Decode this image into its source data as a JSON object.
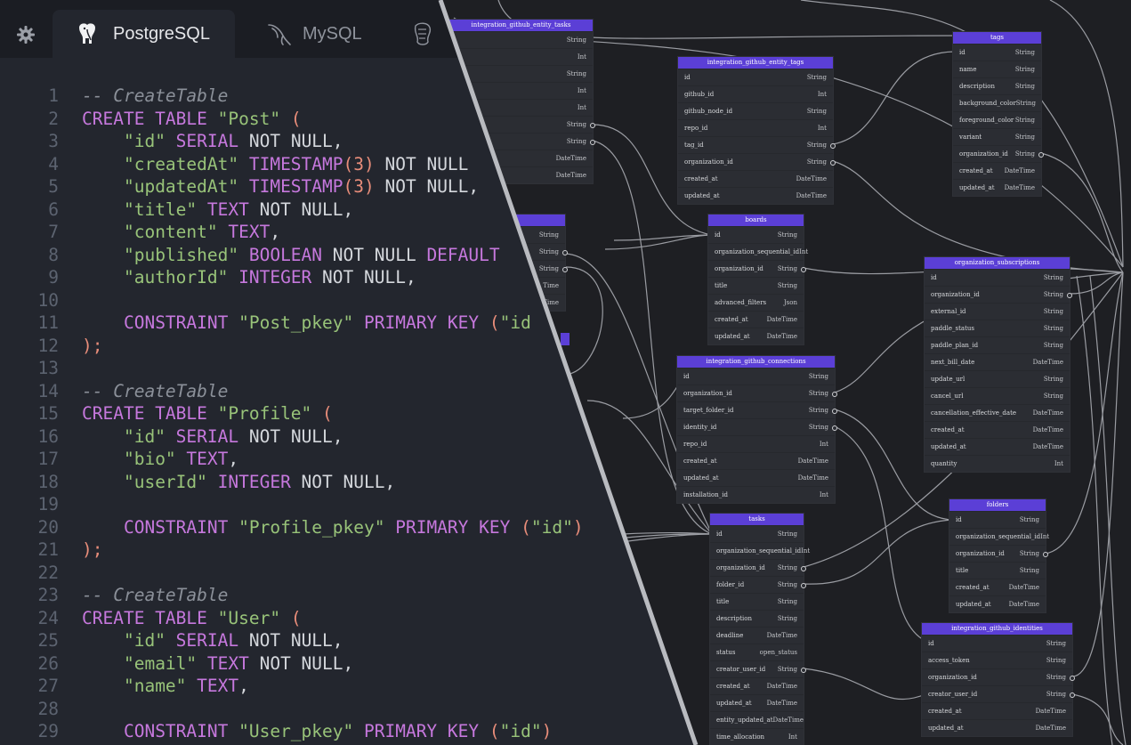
{
  "tabs": [
    {
      "label": "PostgreSQL",
      "icon": "elephant-icon",
      "active": true
    },
    {
      "label": "MySQL",
      "icon": "dolphin-icon",
      "active": false
    },
    {
      "label": "",
      "icon": "database-icon",
      "active": false
    }
  ],
  "code": [
    {
      "n": "1",
      "t": [
        [
          "c",
          "-- CreateTable"
        ]
      ]
    },
    {
      "n": "2",
      "t": [
        [
          "k",
          "CREATE TABLE "
        ],
        [
          "s",
          "\"Post\""
        ],
        [
          "p",
          " ("
        ]
      ]
    },
    {
      "n": "3",
      "t": [
        [
          "d",
          "    "
        ],
        [
          "s",
          "\"id\""
        ],
        [
          "k",
          " SERIAL"
        ],
        [
          "d",
          " NOT NULL,"
        ]
      ]
    },
    {
      "n": "4",
      "t": [
        [
          "d",
          "    "
        ],
        [
          "s",
          "\"createdAt\""
        ],
        [
          "k",
          " TIMESTAMP"
        ],
        [
          "p",
          "(3)"
        ],
        [
          "d",
          " NOT NULL"
        ]
      ]
    },
    {
      "n": "5",
      "t": [
        [
          "d",
          "    "
        ],
        [
          "s",
          "\"updatedAt\""
        ],
        [
          "k",
          " TIMESTAMP"
        ],
        [
          "p",
          "(3)"
        ],
        [
          "d",
          " NOT NULL,"
        ]
      ]
    },
    {
      "n": "6",
      "t": [
        [
          "d",
          "    "
        ],
        [
          "s",
          "\"title\""
        ],
        [
          "k",
          " TEXT"
        ],
        [
          "d",
          " NOT NULL,"
        ]
      ]
    },
    {
      "n": "7",
      "t": [
        [
          "d",
          "    "
        ],
        [
          "s",
          "\"content\""
        ],
        [
          "k",
          " TEXT"
        ],
        [
          "d",
          ","
        ]
      ]
    },
    {
      "n": "8",
      "t": [
        [
          "d",
          "    "
        ],
        [
          "s",
          "\"published\""
        ],
        [
          "k",
          " BOOLEAN"
        ],
        [
          "d",
          " NOT NULL "
        ],
        [
          "k",
          "DEFAULT"
        ]
      ]
    },
    {
      "n": "9",
      "t": [
        [
          "d",
          "    "
        ],
        [
          "s",
          "\"authorId\""
        ],
        [
          "k",
          " INTEGER"
        ],
        [
          "d",
          " NOT NULL,"
        ]
      ]
    },
    {
      "n": "10",
      "t": []
    },
    {
      "n": "11",
      "t": [
        [
          "d",
          "    "
        ],
        [
          "k",
          "CONSTRAINT "
        ],
        [
          "s",
          "\"Post_pkey\""
        ],
        [
          "k",
          " PRIMARY KEY "
        ],
        [
          "p",
          "("
        ],
        [
          "s",
          "\"id"
        ]
      ]
    },
    {
      "n": "12",
      "t": [
        [
          "p",
          ");"
        ]
      ]
    },
    {
      "n": "13",
      "t": []
    },
    {
      "n": "14",
      "t": [
        [
          "c",
          "-- CreateTable"
        ]
      ]
    },
    {
      "n": "15",
      "t": [
        [
          "k",
          "CREATE TABLE "
        ],
        [
          "s",
          "\"Profile\""
        ],
        [
          "p",
          " ("
        ]
      ]
    },
    {
      "n": "16",
      "t": [
        [
          "d",
          "    "
        ],
        [
          "s",
          "\"id\""
        ],
        [
          "k",
          " SERIAL"
        ],
        [
          "d",
          " NOT NULL,"
        ]
      ]
    },
    {
      "n": "17",
      "t": [
        [
          "d",
          "    "
        ],
        [
          "s",
          "\"bio\""
        ],
        [
          "k",
          " TEXT"
        ],
        [
          "d",
          ","
        ]
      ]
    },
    {
      "n": "18",
      "t": [
        [
          "d",
          "    "
        ],
        [
          "s",
          "\"userId\""
        ],
        [
          "k",
          " INTEGER"
        ],
        [
          "d",
          " NOT NULL,"
        ]
      ]
    },
    {
      "n": "19",
      "t": []
    },
    {
      "n": "20",
      "t": [
        [
          "d",
          "    "
        ],
        [
          "k",
          "CONSTRAINT "
        ],
        [
          "s",
          "\"Profile_pkey\""
        ],
        [
          "k",
          " PRIMARY KEY "
        ],
        [
          "p",
          "("
        ],
        [
          "s",
          "\"id\""
        ],
        [
          "p",
          ")"
        ]
      ]
    },
    {
      "n": "21",
      "t": [
        [
          "p",
          ");"
        ]
      ]
    },
    {
      "n": "22",
      "t": []
    },
    {
      "n": "23",
      "t": [
        [
          "c",
          "-- CreateTable"
        ]
      ]
    },
    {
      "n": "24",
      "t": [
        [
          "k",
          "CREATE TABLE "
        ],
        [
          "s",
          "\"User\""
        ],
        [
          "p",
          " ("
        ]
      ]
    },
    {
      "n": "25",
      "t": [
        [
          "d",
          "    "
        ],
        [
          "s",
          "\"id\""
        ],
        [
          "k",
          " SERIAL"
        ],
        [
          "d",
          " NOT NULL,"
        ]
      ]
    },
    {
      "n": "26",
      "t": [
        [
          "d",
          "    "
        ],
        [
          "s",
          "\"email\""
        ],
        [
          "k",
          " TEXT"
        ],
        [
          "d",
          " NOT NULL,"
        ]
      ]
    },
    {
      "n": "27",
      "t": [
        [
          "d",
          "    "
        ],
        [
          "s",
          "\"name\""
        ],
        [
          "k",
          " TEXT"
        ],
        [
          "d",
          ","
        ]
      ]
    },
    {
      "n": "28",
      "t": []
    },
    {
      "n": "29",
      "t": [
        [
          "d",
          "    "
        ],
        [
          "k",
          "CONSTRAINT "
        ],
        [
          "s",
          "\"User_pkey\""
        ],
        [
          "k",
          " PRIMARY KEY "
        ],
        [
          "p",
          "("
        ],
        [
          "s",
          "\"id\""
        ],
        [
          "p",
          ")"
        ]
      ]
    }
  ],
  "tables": [
    {
      "id": "t-egt",
      "name": "integration_github_entity_tasks",
      "rows": [
        [
          "",
          "String"
        ],
        [
          "",
          "Int"
        ],
        [
          "",
          "String"
        ],
        [
          "",
          "Int"
        ],
        [
          "",
          "Int"
        ],
        [
          "",
          "String"
        ],
        [
          "",
          "String"
        ],
        [
          "",
          "DateTime"
        ],
        [
          "",
          "DateTime"
        ]
      ]
    },
    {
      "id": "t-small",
      "name": "",
      "rows": [
        [
          "",
          "String"
        ],
        [
          "",
          "String"
        ],
        [
          "",
          "String"
        ],
        [
          "",
          "Time"
        ],
        [
          "",
          "Time"
        ]
      ]
    },
    {
      "id": "t-egtags",
      "name": "integration_github_entity_tags",
      "rows": [
        [
          "id",
          "String"
        ],
        [
          "github_id",
          "Int"
        ],
        [
          "github_node_id",
          "String"
        ],
        [
          "repo_id",
          "Int"
        ],
        [
          "tag_id",
          "String"
        ],
        [
          "organization_id",
          "String"
        ],
        [
          "created_at",
          "DateTime"
        ],
        [
          "updated_at",
          "DateTime"
        ]
      ]
    },
    {
      "id": "t-tags",
      "name": "tags",
      "rows": [
        [
          "id",
          "String"
        ],
        [
          "name",
          "String"
        ],
        [
          "description",
          "String"
        ],
        [
          "background_color",
          "String"
        ],
        [
          "foreground_color",
          "String"
        ],
        [
          "variant",
          "String"
        ],
        [
          "organization_id",
          "String"
        ],
        [
          "created_at",
          "DateTime"
        ],
        [
          "updated_at",
          "DateTime"
        ]
      ]
    },
    {
      "id": "t-boards",
      "name": "boards",
      "rows": [
        [
          "id",
          "String"
        ],
        [
          "organization_sequential_id",
          "Int"
        ],
        [
          "organization_id",
          "String"
        ],
        [
          "title",
          "String"
        ],
        [
          "advanced_filters",
          "Json"
        ],
        [
          "created_at",
          "DateTime"
        ],
        [
          "updated_at",
          "DateTime"
        ]
      ]
    },
    {
      "id": "t-subs",
      "name": "organization_subscriptions",
      "rows": [
        [
          "id",
          "String"
        ],
        [
          "organization_id",
          "String"
        ],
        [
          "external_id",
          "String"
        ],
        [
          "paddle_status",
          "String"
        ],
        [
          "paddle_plan_id",
          "String"
        ],
        [
          "next_bill_date",
          "DateTime"
        ],
        [
          "update_url",
          "String"
        ],
        [
          "cancel_url",
          "String"
        ],
        [
          "cancellation_effective_date",
          "DateTime"
        ],
        [
          "created_at",
          "DateTime"
        ],
        [
          "updated_at",
          "DateTime"
        ],
        [
          "quantity",
          "Int"
        ]
      ]
    },
    {
      "id": "t-conn",
      "name": "integration_github_connections",
      "rows": [
        [
          "id",
          "String"
        ],
        [
          "organization_id",
          "String"
        ],
        [
          "target_folder_id",
          "String"
        ],
        [
          "identity_id",
          "String"
        ],
        [
          "repo_id",
          "Int"
        ],
        [
          "created_at",
          "DateTime"
        ],
        [
          "updated_at",
          "DateTime"
        ],
        [
          "installation_id",
          "Int"
        ]
      ]
    },
    {
      "id": "t-folders",
      "name": "folders",
      "rows": [
        [
          "id",
          "String"
        ],
        [
          "organization_sequential_id",
          "Int"
        ],
        [
          "organization_id",
          "String"
        ],
        [
          "title",
          "String"
        ],
        [
          "created_at",
          "DateTime"
        ],
        [
          "updated_at",
          "DateTime"
        ]
      ]
    },
    {
      "id": "t-tasks",
      "name": "tasks",
      "rows": [
        [
          "id",
          "String"
        ],
        [
          "organization_sequential_id",
          "Int"
        ],
        [
          "organization_id",
          "String"
        ],
        [
          "folder_id",
          "String"
        ],
        [
          "title",
          "String"
        ],
        [
          "description",
          "String"
        ],
        [
          "deadline",
          "DateTime"
        ],
        [
          "status",
          "open_status"
        ],
        [
          "creator_user_id",
          "String"
        ],
        [
          "created_at",
          "DateTime"
        ],
        [
          "updated_at",
          "DateTime"
        ],
        [
          "entity_updated_at",
          "DateTime"
        ],
        [
          "time_allocation",
          "Int"
        ]
      ]
    },
    {
      "id": "t-ident",
      "name": "integration_github_identities",
      "rows": [
        [
          "id",
          "String"
        ],
        [
          "access_token",
          "String"
        ],
        [
          "organization_id",
          "String"
        ],
        [
          "creator_user_id",
          "String"
        ],
        [
          "created_at",
          "DateTime"
        ],
        [
          "updated_at",
          "DateTime"
        ]
      ]
    }
  ]
}
